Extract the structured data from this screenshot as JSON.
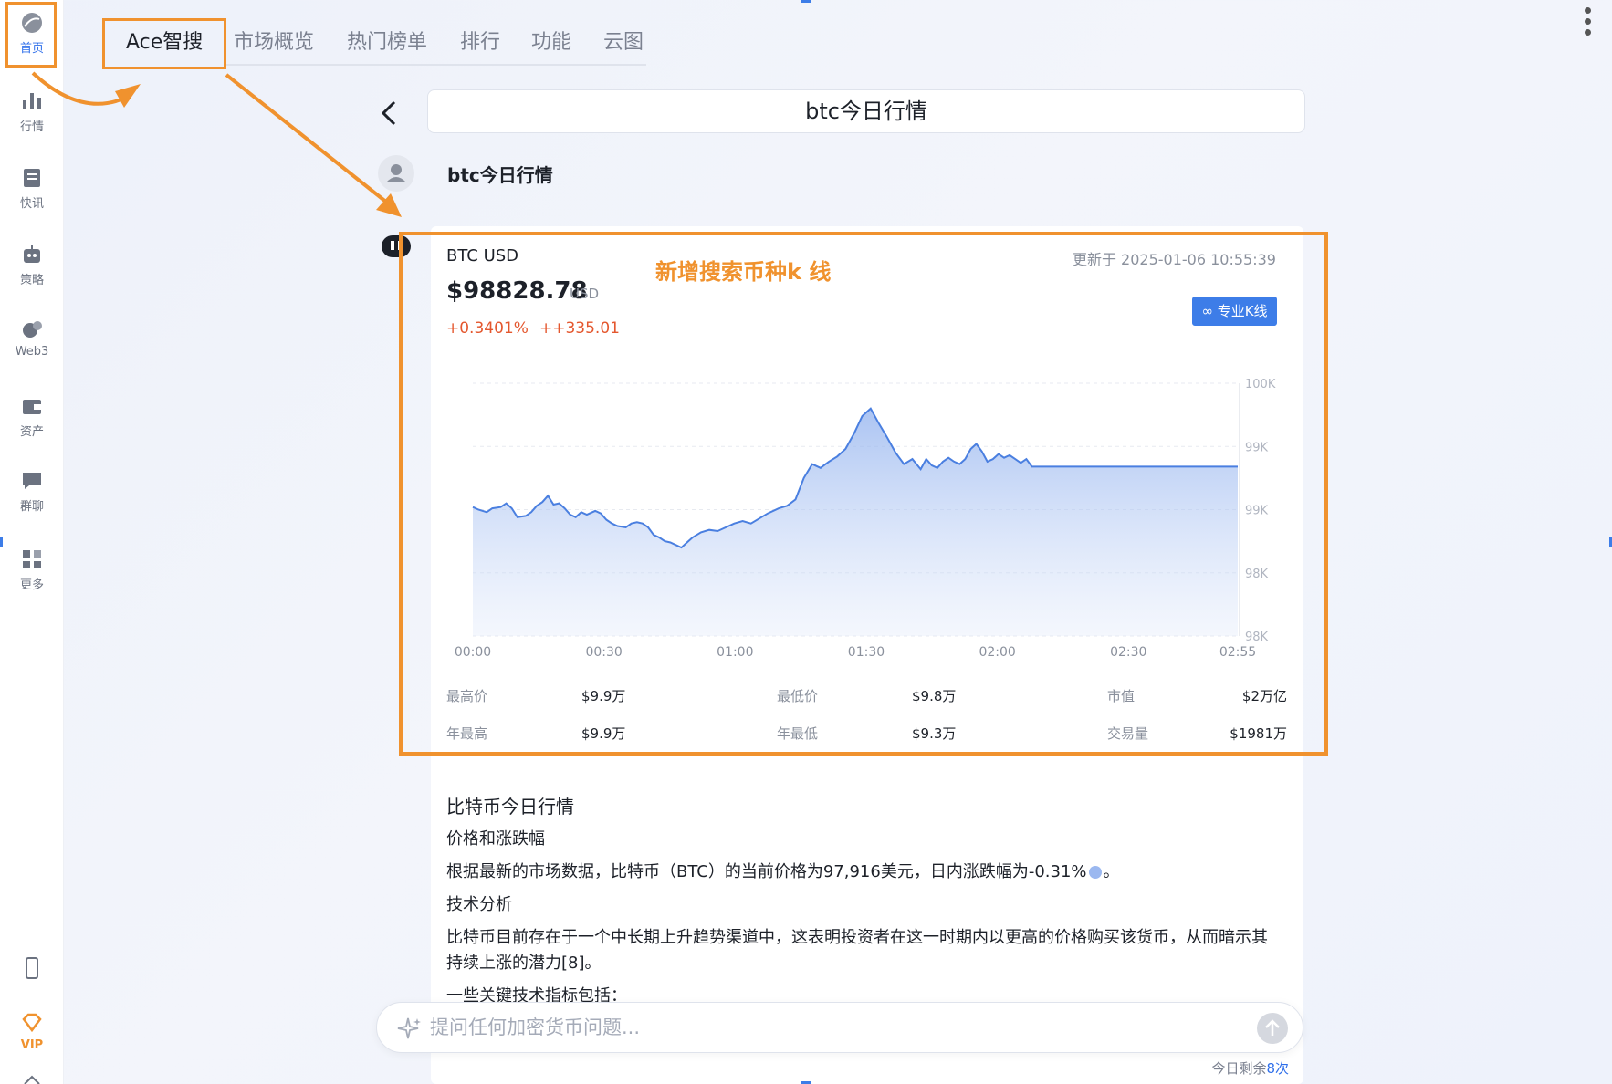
{
  "sidebar": {
    "items": [
      {
        "label": "首页",
        "icon": "home-globe-icon",
        "active": true
      },
      {
        "label": "行情",
        "icon": "bar-chart-icon"
      },
      {
        "label": "快讯",
        "icon": "news-icon"
      },
      {
        "label": "策略",
        "icon": "robot-icon"
      },
      {
        "label": "Web3",
        "icon": "web3-icon"
      },
      {
        "label": "资产",
        "icon": "wallet-icon"
      },
      {
        "label": "群聊",
        "icon": "chat-icon"
      },
      {
        "label": "更多",
        "icon": "grid-more-icon"
      }
    ],
    "vip_label": "VIP"
  },
  "tabs": [
    "Ace智搜",
    "市场概览",
    "热门榜单",
    "排行",
    "功能",
    "云图"
  ],
  "query": "btc今日行情",
  "user_message": "btc今日行情",
  "card": {
    "pair": "BTC USD",
    "updated": "更新于 2025-01-06 10:55:39",
    "price": "$98828.78",
    "price_unit": "USD",
    "change_pct": "+0.3401%",
    "change_abs": "++335.01",
    "annotation": "新增搜索币种k 线",
    "pro_button": "专业K线"
  },
  "chart_data": {
    "type": "area",
    "title": "",
    "x_ticks": [
      "00:00",
      "00:30",
      "01:00",
      "01:30",
      "02:00",
      "02:30",
      "02:55"
    ],
    "y_ticks": [
      "100K",
      "99K",
      "99K",
      "98K",
      "98K"
    ],
    "ylim": [
      97900,
      99900
    ],
    "x_minutes": [
      0,
      2,
      5,
      7,
      10,
      12,
      14,
      16,
      19,
      21,
      23,
      25,
      27,
      29,
      31,
      33,
      35,
      37,
      39,
      41,
      44,
      46,
      48,
      50,
      52,
      55,
      57,
      59,
      61,
      63,
      65,
      67,
      69,
      71,
      73,
      75,
      77,
      79,
      82,
      85,
      88,
      91,
      94,
      97,
      100,
      103,
      106,
      110,
      113,
      116,
      119,
      122,
      125,
      128,
      131,
      134,
      137,
      140,
      143,
      146,
      149,
      152,
      155,
      158,
      161,
      163,
      165,
      167,
      169,
      171,
      173,
      175,
      177,
      179,
      181,
      183,
      185,
      187,
      189,
      191,
      193,
      195,
      197,
      199,
      201,
      203,
      206,
      209,
      212,
      215,
      218,
      221,
      224,
      227,
      230,
      233,
      236,
      239,
      242,
      245,
      248,
      251,
      254,
      257,
      260,
      263,
      266,
      269,
      272,
      275
    ],
    "values": [
      98920,
      98900,
      98880,
      98910,
      98920,
      98950,
      98910,
      98840,
      98850,
      98880,
      98930,
      98960,
      99010,
      98940,
      98950,
      98910,
      98860,
      98840,
      98880,
      98860,
      98890,
      98870,
      98820,
      98790,
      98770,
      98760,
      98790,
      98800,
      98790,
      98760,
      98700,
      98680,
      98650,
      98640,
      98620,
      98600,
      98640,
      98680,
      98720,
      98740,
      98730,
      98760,
      98790,
      98810,
      98790,
      98830,
      98870,
      98910,
      98930,
      98980,
      99150,
      99260,
      99230,
      99280,
      99320,
      99380,
      99500,
      99640,
      99700,
      99580,
      99470,
      99350,
      99260,
      99300,
      99220,
      99300,
      99250,
      99230,
      99280,
      99310,
      99280,
      99260,
      99300,
      99380,
      99420,
      99360,
      99280,
      99300,
      99340,
      99310,
      99330,
      99300,
      99270,
      99300,
      99240
    ],
    "grid": true
  },
  "stats": [
    {
      "k": "最高价",
      "v": "$9.9万"
    },
    {
      "k": "最低价",
      "v": "$9.8万"
    },
    {
      "k": "市值",
      "v": "$2万亿"
    },
    {
      "k": "年最高",
      "v": "$9.9万"
    },
    {
      "k": "年最低",
      "v": "$9.3万"
    },
    {
      "k": "交易量",
      "v": "$1981万"
    }
  ],
  "article": {
    "title": "比特币今日行情",
    "s1": "价格和涨跌幅",
    "p1a": "根据最新的市场数据，比特币（BTC）的当前价格为97,916美元，日内涨跌幅为-0.31%",
    "p1b": "。",
    "s2": "技术分析",
    "p2a": "比特币目前存在于一个中长期上升趋势渠道中，这表明投资者在这一时期内以更高的价格购买该货币，从而暗示其",
    "p2b": "持续上涨的潜力[8]。",
    "p3": "一些关键技术指标包括："
  },
  "ask": {
    "placeholder": "提问任何加密货币问题...",
    "quota_prefix": "今日剩余",
    "quota_count": "8次"
  },
  "colors": {
    "accent": "#2f6fea",
    "annotation": "#f0922e",
    "up": "#e4572e",
    "line": "#4a7fe0"
  }
}
